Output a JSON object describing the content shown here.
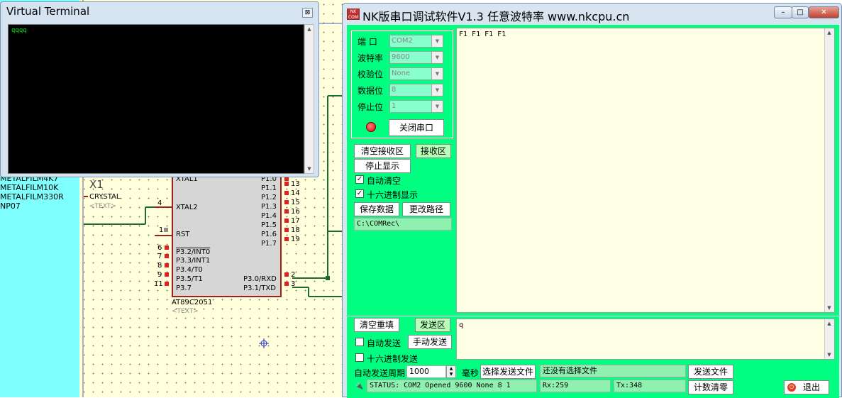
{
  "library": [
    "METALFILM4K7",
    "METALFILM10K",
    "METALFILM330R",
    "NP07"
  ],
  "terminal": {
    "title": "Virtual Terminal",
    "output": "qqqq",
    "close_glyph": "⊠"
  },
  "schematic": {
    "crystal": {
      "ref": "X1",
      "value": "CRYSTAL",
      "text": "<TEXT>"
    },
    "chip": {
      "part": "AT89C2051",
      "text": "<TEXT>"
    },
    "left_pins": [
      {
        "num": "",
        "label": "XTAL1"
      },
      {
        "num": "4",
        "label": "XTAL2"
      },
      {
        "num": "1",
        "label": "RST"
      },
      {
        "num": "6",
        "label": "P3.2/INT0"
      },
      {
        "num": "7",
        "label": "P3.3/INT1"
      },
      {
        "num": "8",
        "label": "P3.4/T0"
      },
      {
        "num": "9",
        "label": "P3.5/T1"
      },
      {
        "num": "11",
        "label": "P3.7"
      }
    ],
    "right_pins": [
      {
        "num": "",
        "label": "P1.0"
      },
      {
        "num": "13",
        "label": "P1.1"
      },
      {
        "num": "14",
        "label": "P1.2"
      },
      {
        "num": "15",
        "label": "P1.3"
      },
      {
        "num": "16",
        "label": "P1.4"
      },
      {
        "num": "17",
        "label": "P1.5"
      },
      {
        "num": "18",
        "label": "P1.6"
      },
      {
        "num": "19",
        "label": "P1.7"
      },
      {
        "num": "2",
        "label": "P3.0/RXD"
      },
      {
        "num": "3",
        "label": "P3.1/TXD"
      }
    ]
  },
  "nk": {
    "logo": "NK COM",
    "title": "NK版串口调试软件V1.3  任意波特率   www.nkcpu.cn",
    "win_buttons": [
      "–",
      "□",
      "✕"
    ],
    "settings": [
      {
        "label": "端  口",
        "value": "COM2"
      },
      {
        "label": "波特率",
        "value": "9600"
      },
      {
        "label": "校验位",
        "value": "None"
      },
      {
        "label": "数据位",
        "value": "8"
      },
      {
        "label": "停止位",
        "value": "1"
      }
    ],
    "close_port": "关闭串口",
    "clear_receive": "清空接收区",
    "receive_area": "接收区",
    "stop_display": "停止显示",
    "auto_clear": "自动清空",
    "hex_display": "十六进制显示",
    "save_data": "保存数据",
    "change_path": "更改路径",
    "path": "C:\\COMRec\\",
    "receive_text": "F1 F1 F1 F1",
    "clear_resend": "清空重填",
    "send_area": "发送区",
    "send_text": "q",
    "auto_send": "自动发送",
    "manual_send": "手动发送",
    "hex_send": "十六进制发送",
    "auto_period_label": "自动发送周期",
    "period": "1000",
    "ms": "毫秒",
    "choose_file": "选择发送文件",
    "file_status": "还没有选择文件",
    "send_file": "发送文件",
    "status": "STATUS: COM2 Opened 9600 None 8 1",
    "rx": "Rx:259",
    "tx": "Tx:348",
    "count_clear": "计数清零",
    "exit": "退出"
  },
  "colors": {
    "client": "#00ff80",
    "receive_bg": "#ffffe6",
    "terminal_text": "#00e000",
    "chip_outline": "#a02020"
  }
}
